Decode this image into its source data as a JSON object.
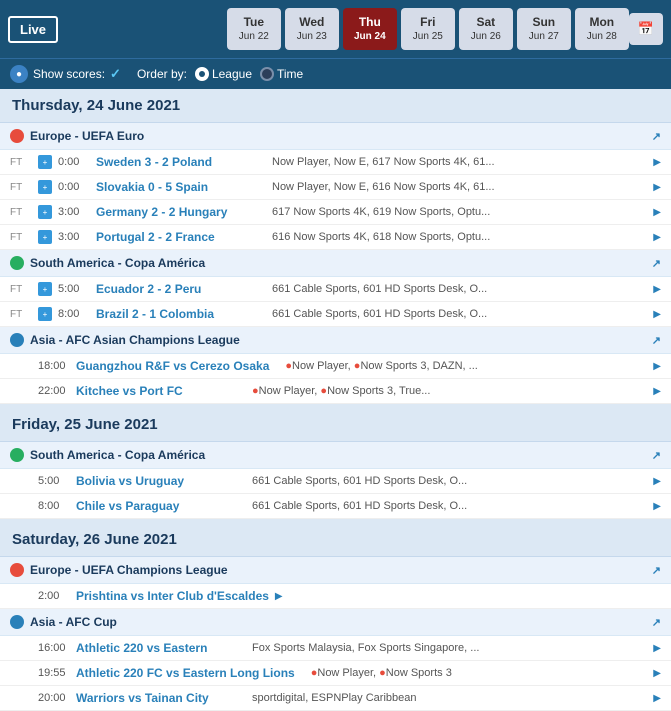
{
  "header": {
    "live_label": "Live",
    "days": [
      {
        "id": "tue",
        "name": "Tue",
        "date": "Jun 22"
      },
      {
        "id": "wed",
        "name": "Wed",
        "date": "Jun 23"
      },
      {
        "id": "thu",
        "name": "Thu",
        "date": "Jun 24",
        "active": true
      },
      {
        "id": "fri",
        "name": "Fri",
        "date": "Jun 25"
      },
      {
        "id": "sat",
        "name": "Sat",
        "date": "Jun 26"
      },
      {
        "id": "sun",
        "name": "Sun",
        "date": "Jun 27"
      },
      {
        "id": "mon",
        "name": "Mon",
        "date": "Jun 28"
      }
    ],
    "cal_icon": "📅"
  },
  "filter_bar": {
    "show_scores_label": "Show scores:",
    "check_mark": "✓",
    "order_by_label": "Order by:",
    "league_label": "League",
    "time_label": "Time"
  },
  "sections": [
    {
      "day_header": "Thursday, 24 June 2021",
      "leagues": [
        {
          "id": "europe-euro",
          "icon_type": "red",
          "name": "Europe - UEFA Euro",
          "matches": [
            {
              "status": "FT",
              "time": "0:00",
              "teams": "Sweden 3 - 2 Poland",
              "channels": "Now Player, Now E, 617 Now Sports 4K, 61..."
            },
            {
              "status": "FT",
              "time": "0:00",
              "teams": "Slovakia 0 - 5 Spain",
              "channels": "Now Player, Now E, 616 Now Sports 4K, 61..."
            },
            {
              "status": "FT",
              "time": "3:00",
              "teams": "Germany 2 - 2 Hungary",
              "channels": "617 Now Sports 4K, 619 Now Sports, Optu..."
            },
            {
              "status": "FT",
              "time": "3:00",
              "teams": "Portugal 2 - 2 France",
              "channels": "616 Now Sports 4K, 618 Now Sports, Optu..."
            }
          ]
        },
        {
          "id": "south-america-copa",
          "icon_type": "green",
          "name": "South America - Copa América",
          "matches": [
            {
              "status": "FT",
              "time": "5:00",
              "teams": "Ecuador 2 - 2 Peru",
              "channels": "661 Cable Sports, 601 HD Sports Desk, O..."
            },
            {
              "status": "FT",
              "time": "8:00",
              "teams": "Brazil 2 - 1 Colombia",
              "channels": "661 Cable Sports, 601 HD Sports Desk, O..."
            }
          ]
        },
        {
          "id": "asia-afc-champions",
          "icon_type": "blue",
          "name": "Asia - AFC Asian Champions League",
          "matches": [
            {
              "status": "",
              "time": "18:00",
              "teams": "Guangzhou R&F vs Cerezo Osaka",
              "channels": "●Now Player, ●Now Sports 3, DAZN, ...",
              "has_red_dot": true
            },
            {
              "status": "",
              "time": "22:00",
              "teams": "Kitchee vs Port FC",
              "channels": "●Now Player, ●Now Sports 3, True...",
              "has_red_dot": true
            }
          ]
        }
      ]
    },
    {
      "day_header": "Friday, 25 June 2021",
      "leagues": [
        {
          "id": "south-america-copa-fri",
          "icon_type": "green",
          "name": "South America - Copa América",
          "matches": [
            {
              "status": "",
              "time": "5:00",
              "teams": "Bolivia vs Uruguay",
              "channels": "661 Cable Sports, 601 HD Sports Desk, O..."
            },
            {
              "status": "",
              "time": "8:00",
              "teams": "Chile vs Paraguay",
              "channels": "661 Cable Sports, 601 HD Sports Desk, O..."
            }
          ]
        }
      ]
    },
    {
      "day_header": "Saturday, 26 June 2021",
      "leagues": [
        {
          "id": "europe-ucl",
          "icon_type": "red",
          "name": "Europe - UEFA Champions League",
          "matches": [
            {
              "status": "",
              "time": "2:00",
              "teams": "Prishtina vs Inter Club d'Escaldes",
              "channels": ""
            }
          ]
        },
        {
          "id": "asia-afc-cup",
          "icon_type": "blue",
          "name": "Asia - AFC Cup",
          "matches": [
            {
              "status": "",
              "time": "16:00",
              "teams": "Athletic 220 vs Eastern",
              "channels": "Fox Sports Malaysia, Fox Sports Singapore, ..."
            },
            {
              "status": "",
              "time": "19:55",
              "teams": "Athletic 220 FC vs Eastern Long Lions",
              "channels": "●Now Player, ●Now Sports 3",
              "has_red_dot": true
            },
            {
              "status": "",
              "time": "20:00",
              "teams": "Warriors vs Tainan City",
              "channels": "sportdigital, ESPNPlay Caribbean"
            }
          ]
        }
      ]
    }
  ]
}
